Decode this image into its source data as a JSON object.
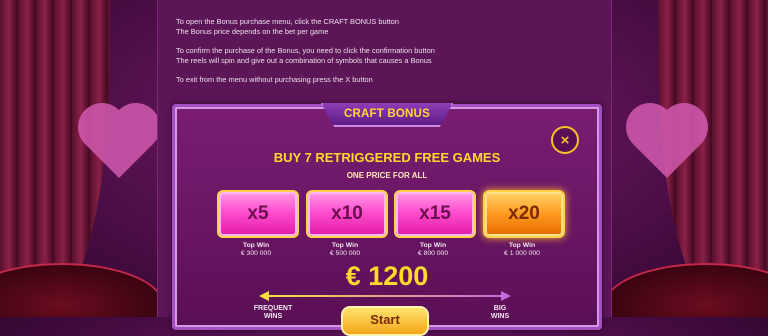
{
  "instructions": {
    "line1": "To open the Bonus purchase menu, click the CRAFT BONUS button",
    "line2": "The Bonus price depends on the bet per game",
    "line3": "To confirm the purchase of the Bonus, you need to click the confirmation button",
    "line4": "The reels will spin and give out a combination of symbols that causes a Bonus",
    "line5": "To exit from the menu without purchasing press the X button"
  },
  "dialog": {
    "title": "CRAFT BONUS",
    "close_icon": "×",
    "headline": "BUY 7 RETRIGGERED FREE GAMES",
    "subline": "ONE PRICE FOR ALL",
    "options": [
      {
        "label": "x5",
        "top_win_label": "Top Win",
        "top_win": "€ 300 000",
        "selected": false
      },
      {
        "label": "x10",
        "top_win_label": "Top Win",
        "top_win": "€ 500 000",
        "selected": false
      },
      {
        "label": "x15",
        "top_win_label": "Top Win",
        "top_win": "€ 800 000",
        "selected": false
      },
      {
        "label": "x20",
        "top_win_label": "Top Win",
        "top_win": "€ 1 000 000",
        "selected": true
      }
    ],
    "price": "€ 1200",
    "frequent_label": "FREQUENT",
    "frequent_label_sub": "WINS",
    "big_label": "BIG",
    "big_label_sub": "WINS",
    "start_label": "Start"
  },
  "colors": {
    "accent": "#ffd92e",
    "option_pink": "#ff4fcf",
    "option_selected": "#ff9a1f",
    "panel": "#5c1556"
  }
}
